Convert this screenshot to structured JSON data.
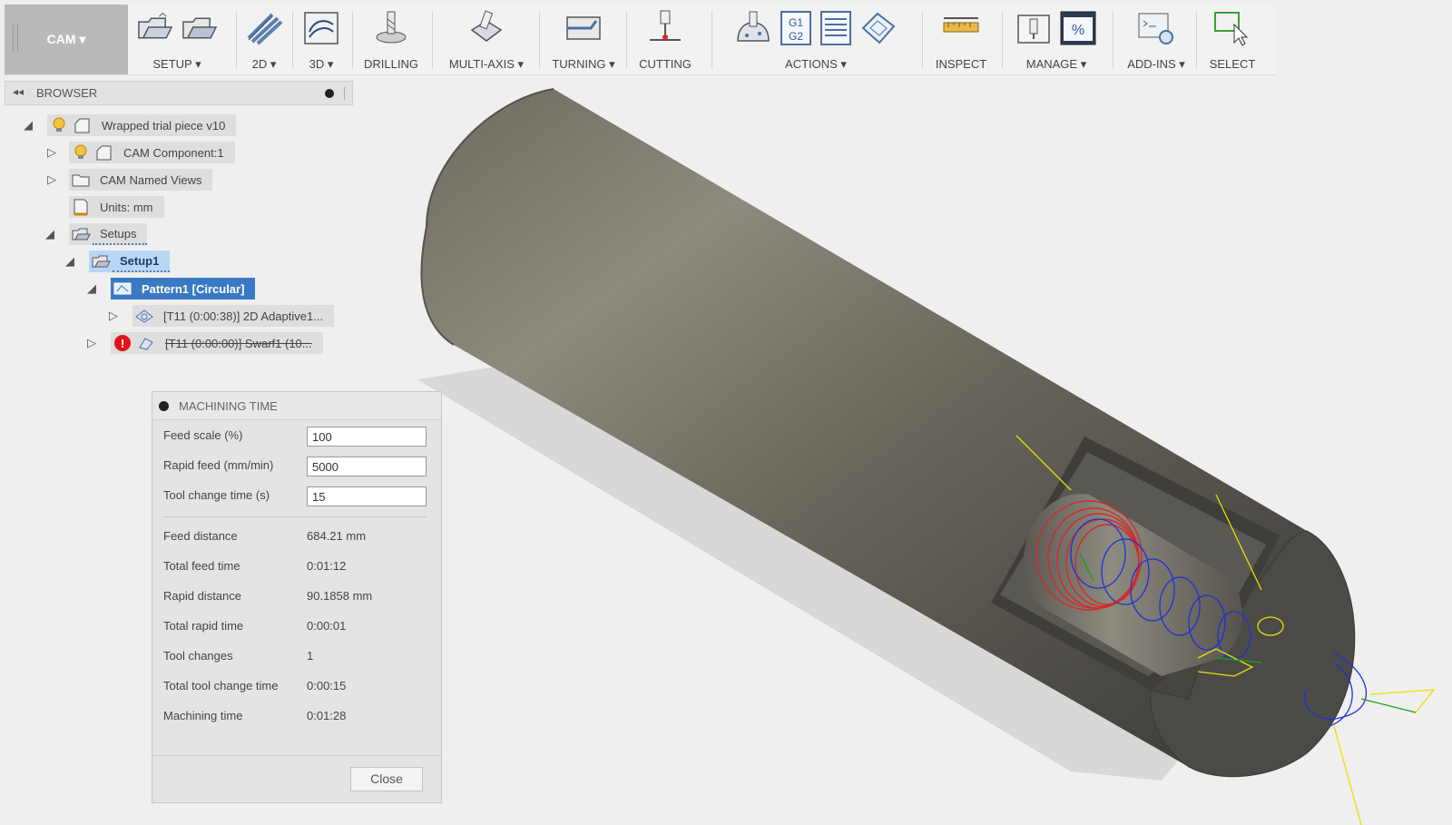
{
  "toolbar": {
    "workspace": "CAM ▾",
    "groups": [
      {
        "label": "SETUP ▾"
      },
      {
        "label": "2D ▾"
      },
      {
        "label": "3D ▾"
      },
      {
        "label": "DRILLING"
      },
      {
        "label": "MULTI-AXIS ▾"
      },
      {
        "label": "TURNING ▾"
      },
      {
        "label": "CUTTING"
      },
      {
        "label": "ACTIONS ▾"
      },
      {
        "label": "INSPECT"
      },
      {
        "label": "MANAGE ▾"
      },
      {
        "label": "ADD-INS ▾"
      },
      {
        "label": "SELECT"
      }
    ],
    "g1g2": [
      "G1",
      "G2"
    ],
    "percent": "%"
  },
  "browser": {
    "title": "BROWSER",
    "tree": {
      "root": "Wrapped trial piece v10",
      "component": "CAM Component:1",
      "named_views": "CAM Named Views",
      "units": "Units: mm",
      "setups": "Setups",
      "setup1": "Setup1",
      "pattern": "Pattern1 [Circular]",
      "op1": "[T11 (0:00:38)] 2D Adaptive1...",
      "op2": "[T11 (0:00:00)] Swarf1 (10...",
      "error_mark": "!"
    }
  },
  "machining_time": {
    "title": "MACHINING TIME",
    "inputs": [
      {
        "label": "Feed scale (%)",
        "value": "100"
      },
      {
        "label": "Rapid feed (mm/min)",
        "value": "5000"
      },
      {
        "label": "Tool change time (s)",
        "value": "15"
      }
    ],
    "results": [
      {
        "label": "Feed distance",
        "value": "684.21 mm"
      },
      {
        "label": "Total feed time",
        "value": "0:01:12"
      },
      {
        "label": "Rapid distance",
        "value": "90.1858 mm"
      },
      {
        "label": "Total rapid time",
        "value": "0:00:01"
      },
      {
        "label": "Tool changes",
        "value": "1"
      },
      {
        "label": "Total tool change time",
        "value": "0:00:15"
      },
      {
        "label": "Machining time",
        "value": "0:01:28"
      }
    ],
    "close_label": "Close"
  },
  "colors": {
    "selected_blue": "#3a79c4",
    "setup_highlight": "#b9d6f5",
    "toolpath_red": "#d42a2a",
    "toolpath_blue": "#2030d8",
    "toolpath_yellow": "#e8e000",
    "error_red": "#e0141c"
  }
}
